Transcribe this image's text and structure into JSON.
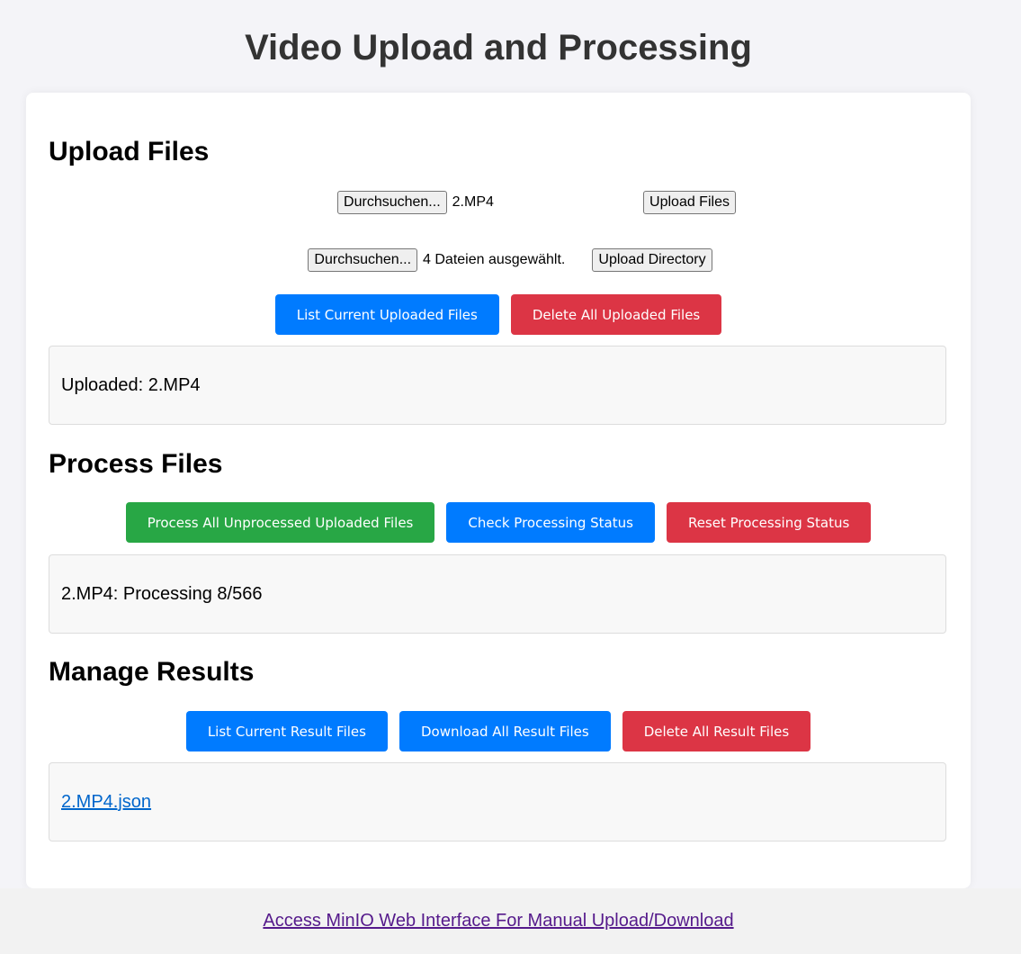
{
  "page": {
    "title": "Video Upload and Processing"
  },
  "upload": {
    "title": "Upload Files",
    "file_browse_label": "Durchsuchen...",
    "file_selected": "2.MP4",
    "upload_files_label": "Upload Files",
    "dir_browse_label": "Durchsuchen...",
    "dir_selected": "4 Dateien ausgewählt.",
    "upload_directory_label": "Upload Directory",
    "list_button": "List Current Uploaded Files",
    "delete_button": "Delete All Uploaded Files",
    "output": "Uploaded: 2.MP4"
  },
  "process": {
    "title": "Process Files",
    "process_button": "Process All Unprocessed Uploaded Files",
    "status_button": "Check Processing Status",
    "reset_button": "Reset Processing Status",
    "output": "2.MP4: Processing 8/566"
  },
  "results": {
    "title": "Manage Results",
    "list_button": "List Current Result Files",
    "download_button": "Download All Result Files",
    "delete_button": "Delete All Result Files",
    "files": [
      "2.MP4.json"
    ]
  },
  "footer": {
    "link": "Access MinIO Web Interface For Manual Upload/Download"
  },
  "colors": {
    "primary": "#007bff",
    "danger": "#dc3545",
    "success": "#28a745",
    "title": "#333333",
    "link": "#0066cc",
    "visited_link": "#551a8b"
  }
}
